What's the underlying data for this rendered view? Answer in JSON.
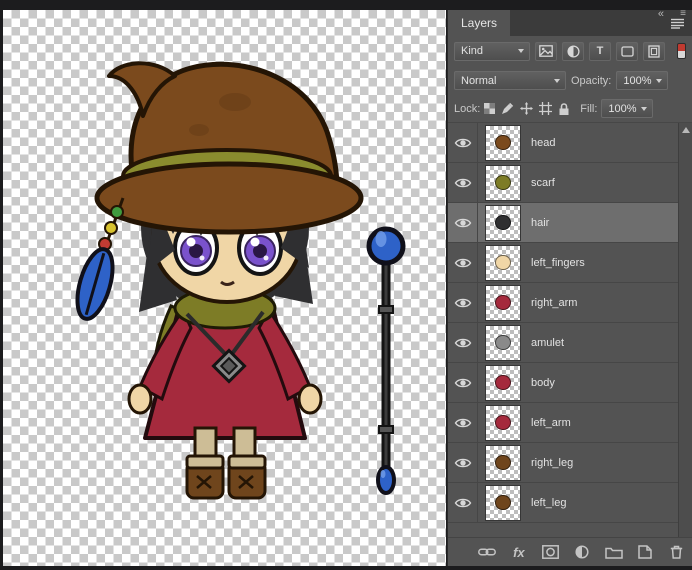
{
  "chrome": {
    "collapse_glyph": "«",
    "corner_glyph": "≡"
  },
  "panel": {
    "tab_label": "Layers",
    "filter": {
      "kind_label": "Kind",
      "icons": [
        "pixel-layer-filter-icon",
        "adjustment-layer-filter-icon",
        "type-layer-filter-icon",
        "shape-layer-filter-icon",
        "smart-object-filter-icon"
      ],
      "type_glyph": "T",
      "toggle": "layer-filter-toggle"
    },
    "blend": {
      "mode_value": "Normal",
      "opacity_label": "Opacity:",
      "opacity_value": "100%"
    },
    "lock": {
      "label": "Lock:",
      "icons": [
        "lock-transparent-pixels-icon",
        "lock-image-pixels-icon",
        "lock-position-icon",
        "lock-artboard-icon",
        "lock-all-icon"
      ],
      "fill_label": "Fill:",
      "fill_value": "100%"
    },
    "layers": [
      {
        "name": "head",
        "thumb_color": "#7b4a1d",
        "selected": false
      },
      {
        "name": "scarf",
        "thumb_color": "#7d7c26",
        "selected": false
      },
      {
        "name": "hair",
        "thumb_color": "#2f2f31",
        "selected": true
      },
      {
        "name": "left_fingers",
        "thumb_color": "#f0d6a6",
        "selected": false
      },
      {
        "name": "right_arm",
        "thumb_color": "#a52a3d",
        "selected": false
      },
      {
        "name": "amulet",
        "thumb_color": "#8a8a8a",
        "selected": false
      },
      {
        "name": "body",
        "thumb_color": "#a52a3d",
        "selected": false
      },
      {
        "name": "left_arm",
        "thumb_color": "#a52a3d",
        "selected": false
      },
      {
        "name": "right_leg",
        "thumb_color": "#6f451c",
        "selected": false
      },
      {
        "name": "left_leg",
        "thumb_color": "#6f451c",
        "selected": false
      }
    ],
    "bottom_bar": {
      "fx_label": "fx",
      "icons": [
        "link-layers-icon",
        "layer-style-icon",
        "add-layer-mask-icon",
        "new-adjustment-layer-icon",
        "new-group-icon",
        "new-layer-icon",
        "delete-layer-icon"
      ]
    }
  },
  "canvas": {
    "artwork": "chibi witch character with bead-and-feather hat, amulet, and blue-orb staff",
    "colors": {
      "hat": "#7b4a1d",
      "hat_band": "#8a8c2e",
      "hair": "#2f2f31",
      "skin": "#f0d6a6",
      "eye_iris": "#7a52cc",
      "eye_pupil": "#2a1744",
      "dress": "#a52a3d",
      "scarf": "#7d7c26",
      "boots": "#6f451c",
      "sock": "#cdbd96",
      "staff_orb": "#2e62c8",
      "amulet": "#8a8a8a",
      "feather": "#2e62c8"
    }
  }
}
